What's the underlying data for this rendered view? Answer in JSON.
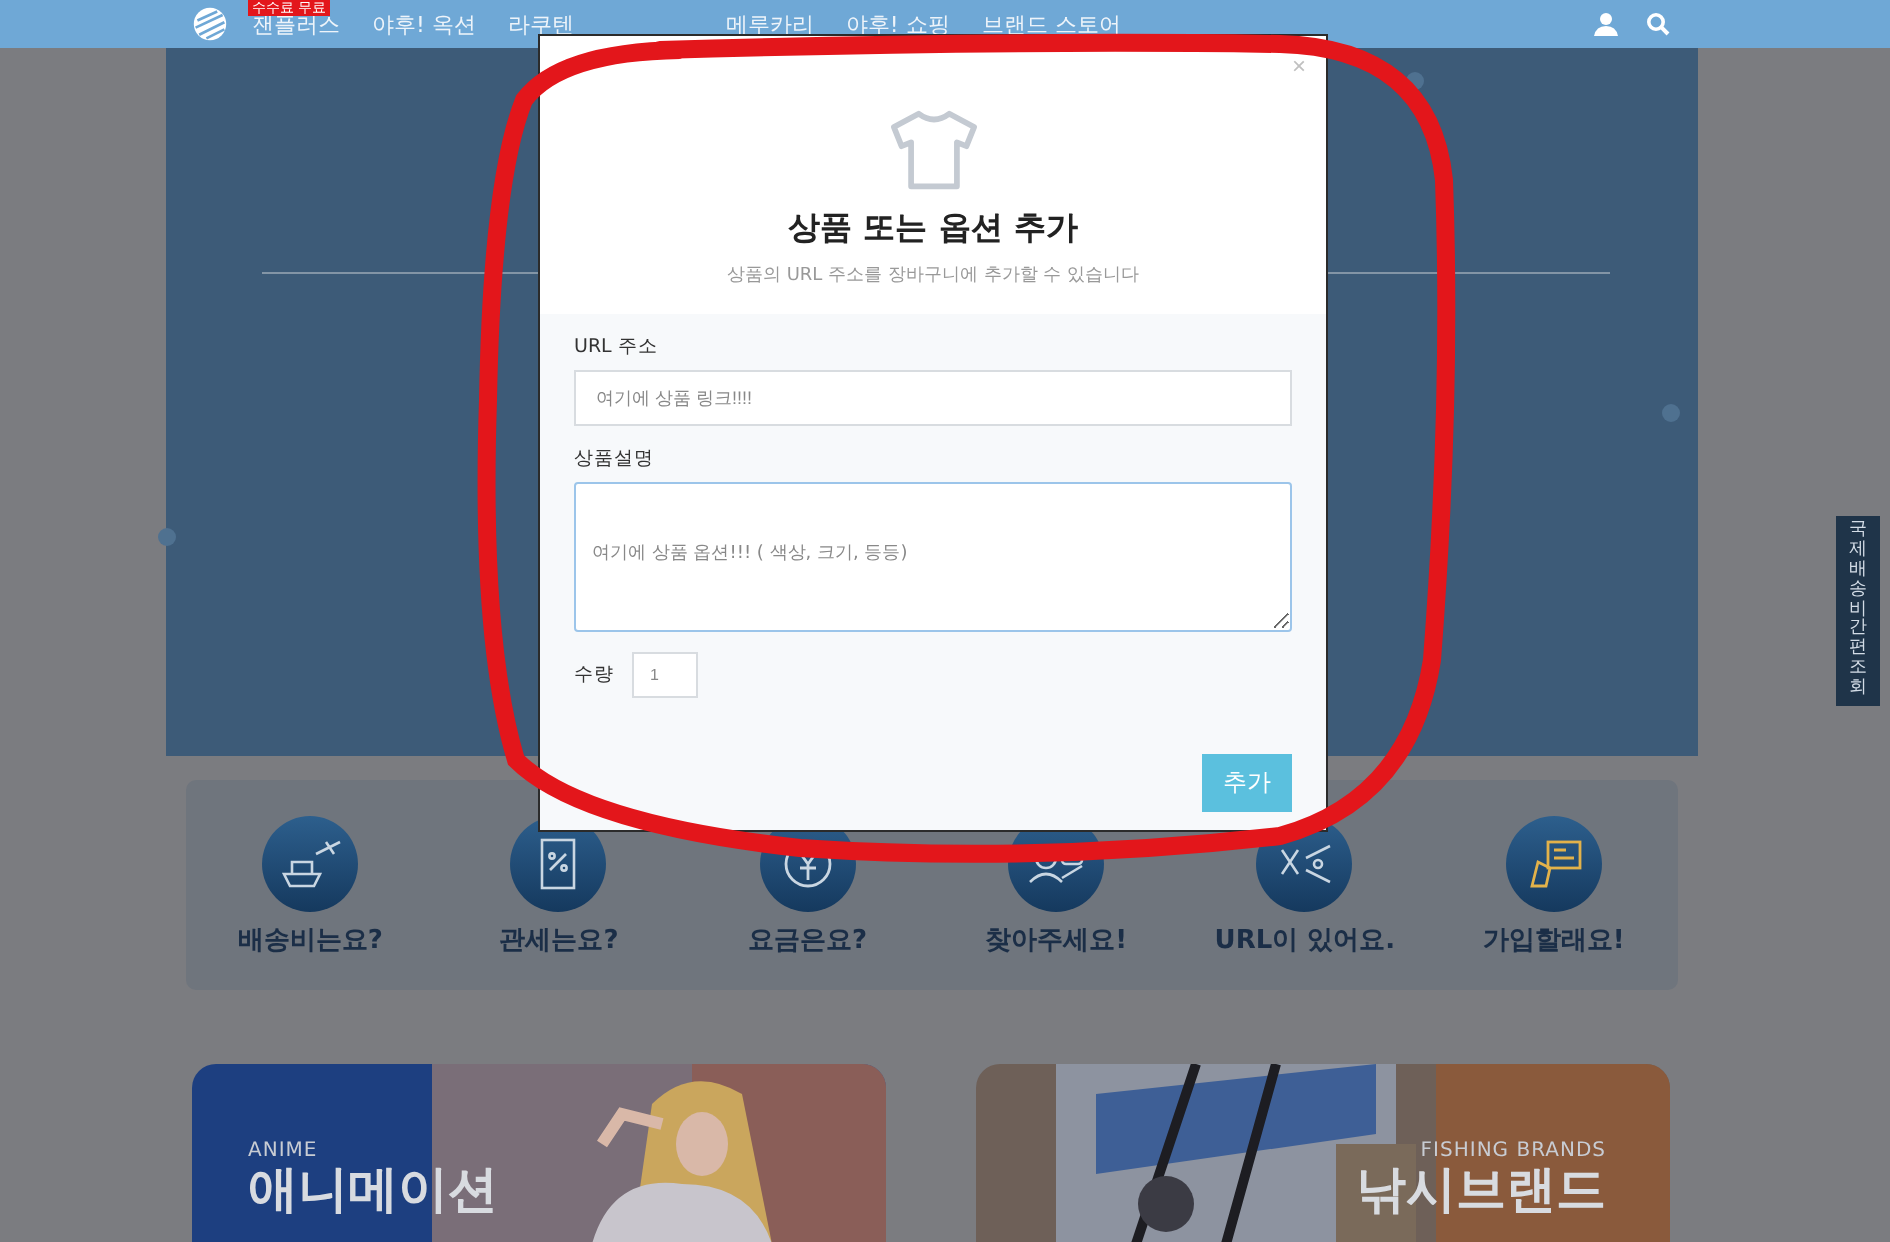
{
  "nav": {
    "badge": "수수료 무료",
    "items": [
      "잰플러스",
      "야후! 옥션",
      "라쿠텐",
      "메루카리",
      "야후! 쇼핑",
      "브랜드 스토어"
    ]
  },
  "side_tab": {
    "label": "국제배송비 간편조회"
  },
  "modal": {
    "close": "×",
    "title": "상품 또는 옵션 추가",
    "subtitle": "상품의 URL 주소를 장바구니에 추가할 수 있습니다",
    "url_label": "URL 주소",
    "url_placeholder": "여기에 상품 링크!!!!",
    "desc_label": "상품설명",
    "desc_placeholder": "여기에 상품 옵션!!! ( 색상, 크기, 등등)",
    "qty_label": "수량",
    "qty_placeholder": "1",
    "submit": "추가"
  },
  "shortcuts": [
    {
      "label": "배송비는요?"
    },
    {
      "label": "관세는요?"
    },
    {
      "label": "요금은요?"
    },
    {
      "label": "찾아주세요!"
    },
    {
      "label": "URL이 있어요."
    },
    {
      "label": "가입할래요!"
    }
  ],
  "banners": [
    {
      "kind": "anime",
      "eyebrow": "ANIME",
      "title": "애니메이션"
    },
    {
      "kind": "fishing",
      "eyebrow": "FISHING BRANDS",
      "title": "낚시브랜드"
    }
  ]
}
